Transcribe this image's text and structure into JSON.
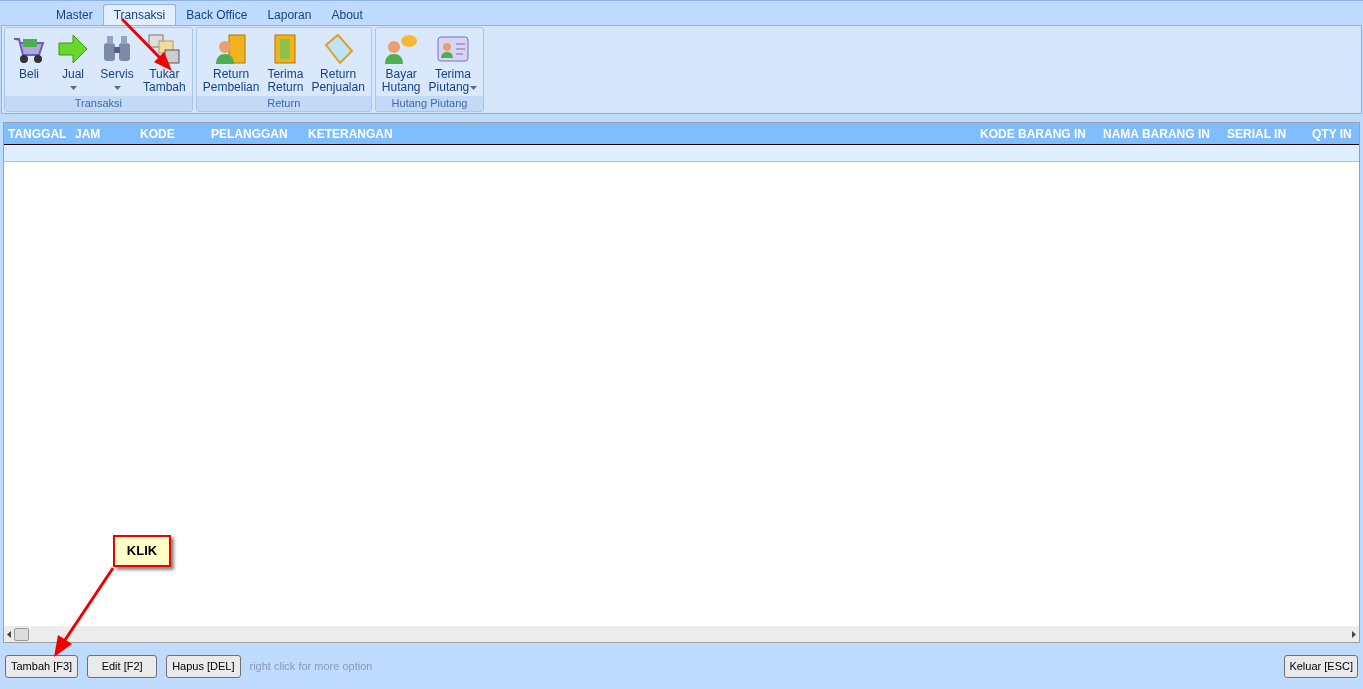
{
  "tabs": [
    {
      "label": "Master",
      "selected": false
    },
    {
      "label": "Transaksi",
      "selected": true
    },
    {
      "label": "Back Office",
      "selected": false
    },
    {
      "label": "Laporan",
      "selected": false
    },
    {
      "label": "About",
      "selected": false
    }
  ],
  "ribbon_groups": [
    {
      "title": "Transaksi",
      "items": [
        {
          "label": [
            "Beli"
          ],
          "dropdown": false
        },
        {
          "label": [
            "Jual"
          ],
          "dropdown": true
        },
        {
          "label": [
            "Servis"
          ],
          "dropdown": true
        },
        {
          "label": [
            "Tukar",
            "Tambah"
          ],
          "dropdown": false
        }
      ]
    },
    {
      "title": "Return",
      "items": [
        {
          "label": [
            "Return",
            "Pembelian"
          ],
          "dropdown": false
        },
        {
          "label": [
            "Terima",
            "Return"
          ],
          "dropdown": false
        },
        {
          "label": [
            "Return",
            "Penjualan"
          ],
          "dropdown": false
        }
      ]
    },
    {
      "title": "Hutang Piutang",
      "items": [
        {
          "label": [
            "Bayar",
            "Hutang"
          ],
          "dropdown": false
        },
        {
          "label": [
            "Terima",
            "Piutang"
          ],
          "dropdown": true
        }
      ]
    }
  ],
  "table": {
    "columns": [
      "TANGGAL",
      "JAM",
      "KODE",
      "PELANGGAN",
      "KETERANGAN",
      "KODE BARANG IN",
      "NAMA BARANG IN",
      "SERIAL IN",
      "QTY IN"
    ]
  },
  "buttons": [
    "Tambah [F3]",
    "Edit [F2]",
    "Hapus [DEL]"
  ],
  "hint": "right click for more option",
  "exit_button": "Keluar [ESC]",
  "callout": "KLIK"
}
